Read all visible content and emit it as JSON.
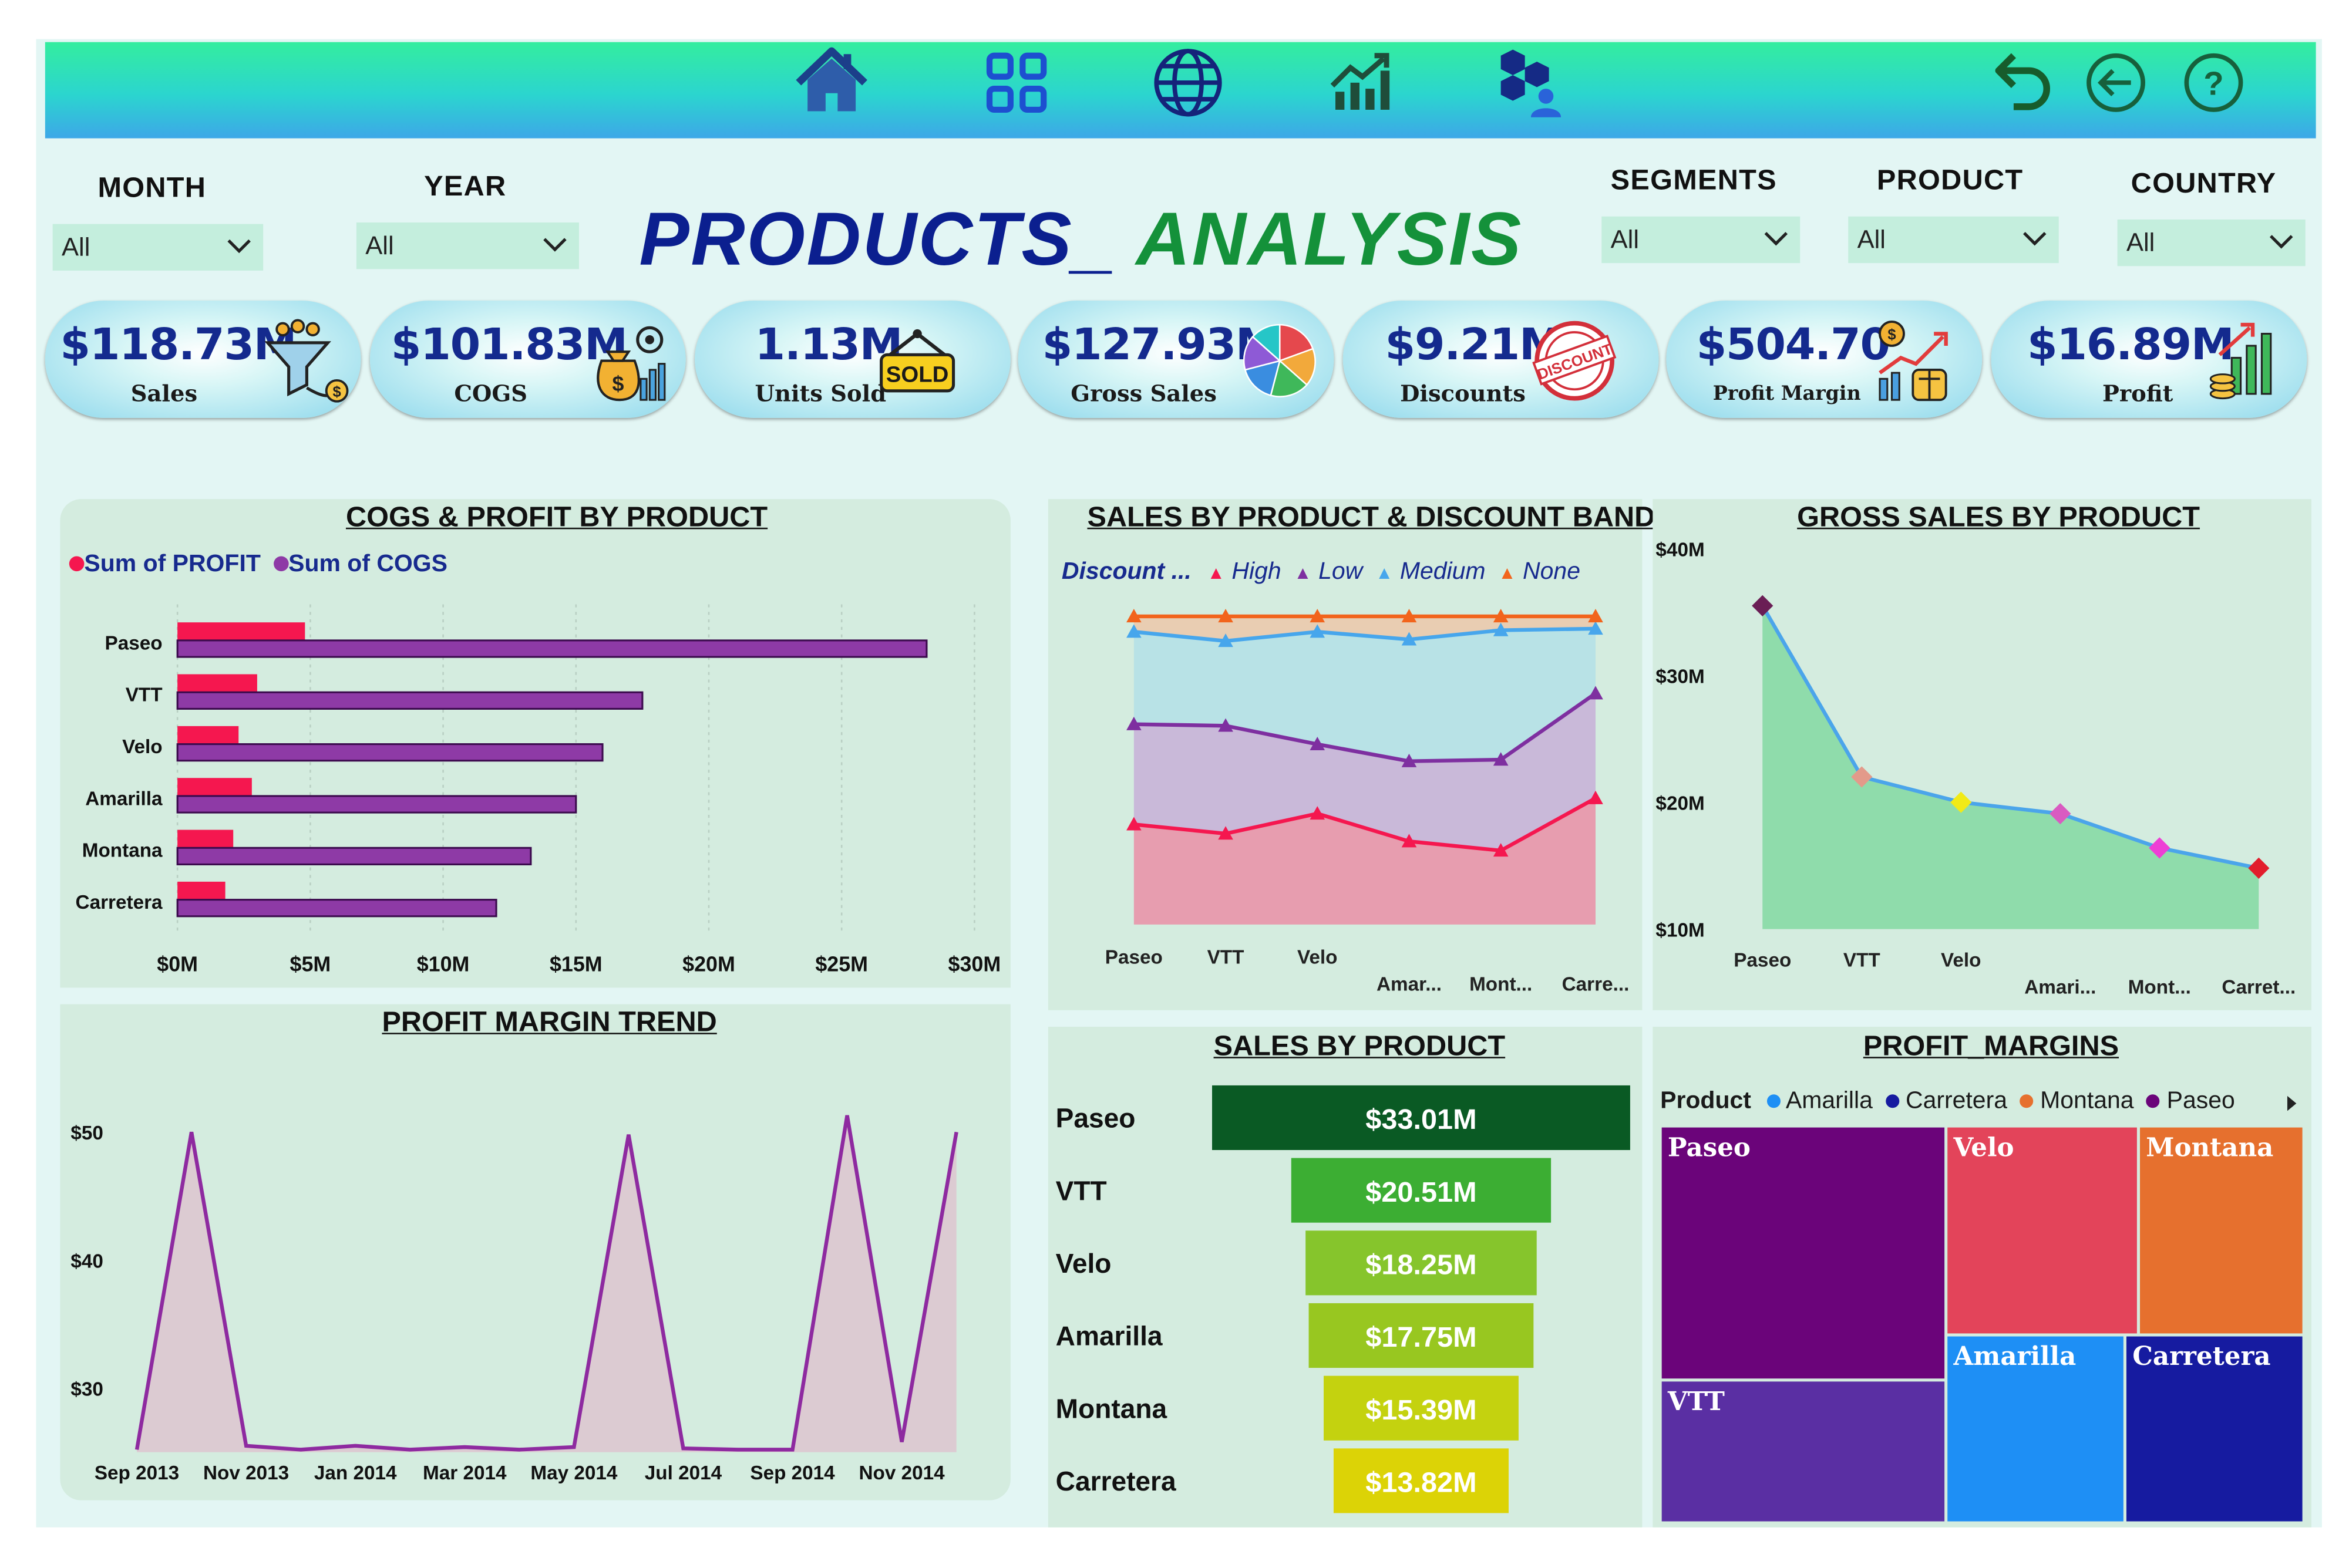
{
  "header": {
    "title_part1": "PRODUCTS_",
    "title_part2": "ANALYSIS",
    "colors": {
      "title_part1": "#0b1f8f",
      "title_part2": "#14913a",
      "kpi_value": "#142a8e"
    }
  },
  "nav": {
    "icons": [
      "home-icon",
      "apps-grid-icon",
      "globe-icon",
      "growth-chart-icon",
      "segments-user-icon"
    ],
    "right_icons": [
      "back-arrow-icon",
      "left-circle-arrow-icon",
      "help-icon"
    ]
  },
  "filters": {
    "month": {
      "label": "MONTH",
      "value": "All"
    },
    "year": {
      "label": "YEAR",
      "value": "All"
    },
    "segments": {
      "label": "SEGMENTS",
      "value": "All"
    },
    "product": {
      "label": "PRODUCT",
      "value": "All"
    },
    "country": {
      "label": "COUNTRY",
      "value": "All"
    }
  },
  "kpis": [
    {
      "value": "$118.73M",
      "label": "Sales",
      "icon": "funnel-people-icon"
    },
    {
      "value": "$101.83M",
      "label": "COGS",
      "icon": "money-bag-gear-icon"
    },
    {
      "value": "1.13M",
      "label": "Units Sold",
      "icon": "sold-sign-icon"
    },
    {
      "value": "$127.93M",
      "label": "Gross Sales",
      "icon": "pie-chart-icon"
    },
    {
      "value": "$9.21M",
      "label": "Discounts",
      "icon": "discount-stamp-icon"
    },
    {
      "value": "$504.70",
      "label": "Profit Margin",
      "icon": "profit-chart-icon"
    },
    {
      "value": "$16.89M",
      "label": "Profit",
      "icon": "coins-growth-icon"
    }
  ],
  "panels": {
    "cogs_profit": {
      "title": "COGS & PROFIT BY PRODUCT",
      "legend": [
        "Sum of PROFIT",
        "Sum of  COGS"
      ]
    },
    "sales_discount": {
      "title": "SALES BY PRODUCT & DISCOUNT BAND",
      "legend_title": "Discount ...",
      "legend": [
        "High",
        "Low",
        "Medium",
        "None"
      ]
    },
    "gross_sales": {
      "title": "GROSS SALES BY PRODUCT"
    },
    "profit_trend": {
      "title": "PROFIT MARGIN TREND"
    },
    "sales_by_product": {
      "title": "SALES BY PRODUCT"
    },
    "profit_margins": {
      "title": "PROFIT_MARGINS",
      "legend_title": "Product",
      "legend": [
        "Amarilla",
        "Carretera",
        "Montana",
        "Paseo"
      ]
    }
  },
  "chart_data": [
    {
      "id": "cogs_profit",
      "type": "bar",
      "orientation": "horizontal",
      "categories": [
        "Paseo",
        "VTT",
        "Velo",
        "Amarilla",
        "Montana",
        "Carretera"
      ],
      "series": [
        {
          "name": "Sum of PROFIT",
          "color": "#f5174f",
          "values": [
            4.8,
            3.0,
            2.3,
            2.8,
            2.1,
            1.8
          ]
        },
        {
          "name": "Sum of  COGS",
          "color": "#8e3aa6",
          "values": [
            28.2,
            17.5,
            16.0,
            15.0,
            13.3,
            12.0
          ]
        }
      ],
      "x_ticks": [
        "$0M",
        "$5M",
        "$10M",
        "$15M",
        "$20M",
        "$25M",
        "$30M"
      ],
      "xlim": [
        0,
        30
      ]
    },
    {
      "id": "sales_discount",
      "type": "area",
      "stacked": true,
      "categories": [
        "Paseo",
        "VTT",
        "Velo",
        "Amar...",
        "Mont...",
        "Carre..."
      ],
      "series": [
        {
          "name": "High",
          "color": "#f5174f",
          "fill": "#e79daf",
          "values": [
            0.325,
            0.295,
            0.36,
            0.27,
            0.24,
            0.41
          ]
        },
        {
          "name": "Low",
          "color": "#7e2fa0",
          "fill": "#c9b9d9",
          "values": [
            0.65,
            0.645,
            0.585,
            0.53,
            0.535,
            0.75
          ]
        },
        {
          "name": "Medium",
          "color": "#47a6ec",
          "fill": "#b8e2e6",
          "values": [
            0.95,
            0.92,
            0.95,
            0.925,
            0.955,
            0.96
          ]
        },
        {
          "name": "None",
          "color": "#f2641c",
          "fill": "#e9cdb2",
          "values": [
            1.0,
            1.0,
            1.0,
            1.0,
            1.0,
            1.0
          ]
        }
      ]
    },
    {
      "id": "gross_sales",
      "type": "area",
      "categories": [
        "Paseo",
        "VTT",
        "Velo",
        "Amari...",
        "Mont...",
        "Carret..."
      ],
      "values": [
        35.5,
        22.0,
        20.0,
        19.1,
        16.4,
        14.8
      ],
      "y_ticks": [
        "$40M",
        "$30M",
        "$20M",
        "$10M"
      ],
      "ylim": [
        10,
        40
      ],
      "marker_colors": [
        "#6a1e55",
        "#e39a8a",
        "#f1ea17",
        "#d95bc1",
        "#ee3fd5",
        "#e21d2c"
      ],
      "line_color": "#4ba5ea",
      "fill": "#8fdcab"
    },
    {
      "id": "profit_trend",
      "type": "line",
      "x_ticks": [
        "Sep 2013",
        "Nov 2013",
        "Jan 2014",
        "Mar 2014",
        "May 2014",
        "Jul 2014",
        "Sep 2014",
        "Nov 2014"
      ],
      "values": [
        25.2,
        50.0,
        25.5,
        25.2,
        25.5,
        25.2,
        25.4,
        25.2,
        25.4,
        49.8,
        25.3,
        25.2,
        25.2,
        51.3,
        25.8,
        50.0
      ],
      "y_ticks": [
        "$50",
        "$40",
        "$30"
      ],
      "ylim": [
        25,
        52
      ],
      "line_color": "#8e2aa0",
      "fill": "#dccbd2"
    },
    {
      "id": "sales_by_product",
      "type": "bar",
      "orientation": "funnel",
      "categories": [
        "Paseo",
        "VTT",
        "Velo",
        "Amarilla",
        "Montana",
        "Carretera"
      ],
      "values": [
        33.01,
        20.51,
        18.25,
        17.75,
        15.39,
        13.82
      ],
      "labels": [
        "$33.01M",
        "$20.51M",
        "$18.25M",
        "$17.75M",
        "$15.39M",
        "$13.82M"
      ],
      "colors": [
        "#0a5a24",
        "#3cae33",
        "#86c52c",
        "#98c720",
        "#c4d20f",
        "#dcd306"
      ]
    },
    {
      "id": "profit_margins",
      "type": "treemap",
      "tiles": [
        {
          "name": "Paseo",
          "color": "#6b047a"
        },
        {
          "name": "Velo",
          "color": "#e3445a"
        },
        {
          "name": "Montana",
          "color": "#e6702e"
        },
        {
          "name": "VTT",
          "color": "#5a2fa3"
        },
        {
          "name": "Amarilla",
          "color": "#1e8ff5"
        },
        {
          "name": "Carretera",
          "color": "#161ba0"
        }
      ]
    }
  ]
}
